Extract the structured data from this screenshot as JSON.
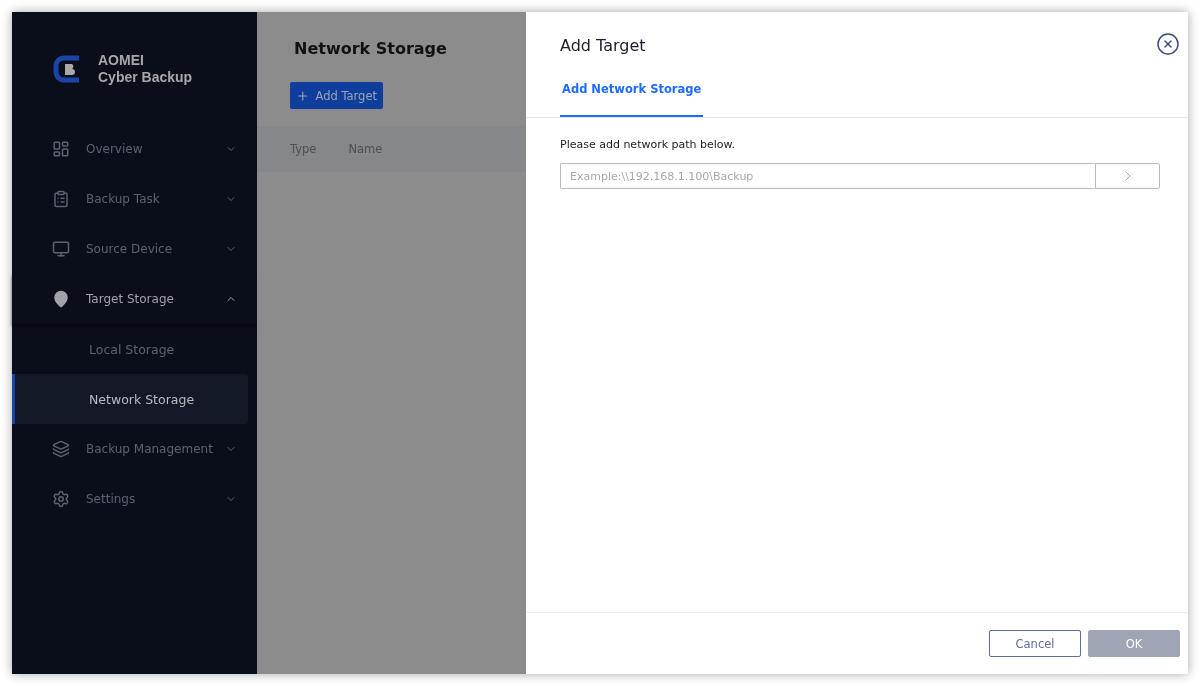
{
  "logo": {
    "line1": "AOMEI",
    "line2": "Cyber Backup"
  },
  "sidebar": {
    "items": [
      {
        "kind": "overview",
        "label": "Overview",
        "expanded": false
      },
      {
        "kind": "task",
        "label": "Backup Task",
        "expanded": false
      },
      {
        "kind": "device",
        "label": "Source Device",
        "expanded": false
      },
      {
        "kind": "target",
        "label": "Target Storage",
        "expanded": true,
        "children": [
          {
            "label": "Local Storage",
            "selected": false
          },
          {
            "label": "Network Storage",
            "selected": true
          }
        ]
      },
      {
        "kind": "management",
        "label": "Backup Management",
        "expanded": false
      },
      {
        "kind": "settings",
        "label": "Settings",
        "expanded": false
      }
    ]
  },
  "page": {
    "title": "Network Storage",
    "add_button": "Add Target",
    "columns": [
      "Type",
      "Name"
    ]
  },
  "dialog": {
    "title": "Add Target",
    "tabs": [
      {
        "label": "Add Network Storage",
        "selected": true
      }
    ],
    "instruction": "Please add network path below.",
    "path_field": {
      "placeholder": "Example:\\\\192.168.1.100\\Backup"
    },
    "buttons": [
      {
        "kind": "cancel",
        "label": "Cancel",
        "disabled": false
      },
      {
        "kind": "ok",
        "label": "OK",
        "disabled": true
      }
    ]
  }
}
